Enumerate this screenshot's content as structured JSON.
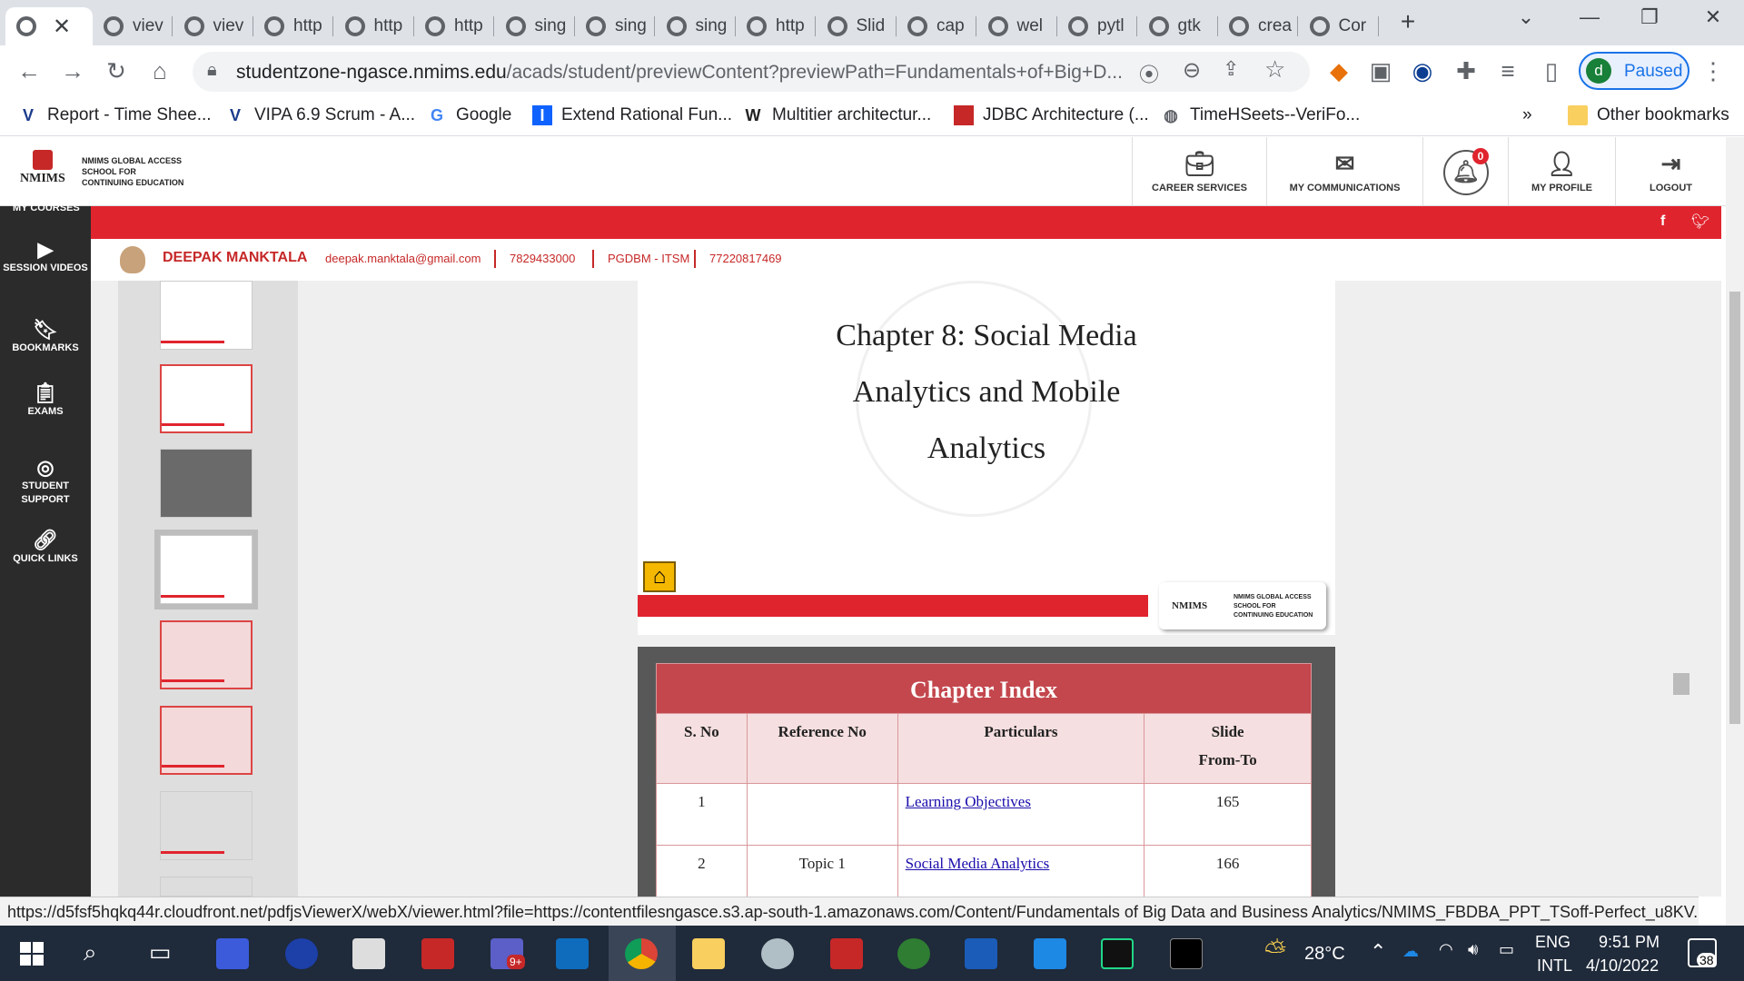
{
  "browser": {
    "tabs": [
      {
        "label": "viev"
      },
      {
        "label": "viev"
      },
      {
        "label": "http"
      },
      {
        "label": "http"
      },
      {
        "label": "http"
      },
      {
        "label": "sing"
      },
      {
        "label": "sing"
      },
      {
        "label": "sing"
      },
      {
        "label": "http"
      },
      {
        "label": "Slid"
      },
      {
        "label": "cap"
      },
      {
        "label": "wel"
      },
      {
        "label": "pytl"
      },
      {
        "label": "gtk"
      },
      {
        "label": "crea"
      },
      {
        "label": "Cor"
      }
    ],
    "url_host": "studentzone-ngasce.nmims.edu",
    "url_rest": "/acads/student/previewContent?previewPath=Fundamentals+of+Big+D...",
    "profile_initial": "d",
    "profile_status": "Paused"
  },
  "bookmarks": [
    {
      "label": "Report - Time Shee...",
      "icon": "v-logo-icon"
    },
    {
      "label": "VIPA 6.9 Scrum - A...",
      "icon": "v-logo-icon"
    },
    {
      "label": "Google",
      "icon": "google-icon"
    },
    {
      "label": "Extend Rational Fun...",
      "icon": "ibm-icon"
    },
    {
      "label": "Multitier architectur...",
      "icon": "wikipedia-icon"
    },
    {
      "label": "JDBC Architecture (...",
      "icon": "red-box-icon"
    },
    {
      "label": "TimeHSeets--VeriFo...",
      "icon": "globe-icon"
    }
  ],
  "bookmarks_more": "»",
  "other_bookmarks": "Other bookmarks",
  "site": {
    "logo_text": "NMIMS",
    "logo_lines": [
      "NMIMS GLOBAL ACCESS",
      "SCHOOL FOR",
      "CONTINUING EDUCATION"
    ],
    "nav": [
      {
        "label": "CAREER SERVICES",
        "icon": "briefcase-icon"
      },
      {
        "label": "MY COMMUNICATIONS",
        "icon": "envelope-icon"
      },
      {
        "label": "",
        "icon": "bell-icon",
        "badge": "0"
      },
      {
        "label": "MY PROFILE",
        "icon": "user-icon"
      },
      {
        "label": "LOGOUT",
        "icon": "logout-icon"
      }
    ],
    "my_courses": "MY COURSES"
  },
  "user": {
    "name": "DEEPAK MANKTALA",
    "email": "deepak.manktala@gmail.com",
    "phone": "7829433000",
    "program": "PGDBM - ITSM",
    "id": "77220817469"
  },
  "sidebar": [
    {
      "label": "SESSION VIDEOS",
      "icon": "play-icon"
    },
    {
      "label": "BOOKMARKS",
      "icon": "bookmark-icon"
    },
    {
      "label": "EXAMS",
      "icon": "exam-icon"
    },
    {
      "label": "STUDENT SUPPORT",
      "icon": "lifebuoy-icon"
    },
    {
      "label": "QUICK LINKS",
      "icon": "link-icon"
    }
  ],
  "slide": {
    "title_lines": [
      "Chapter 8: Social Media",
      "Analytics and Mobile",
      "Analytics"
    ]
  },
  "chapter_index": {
    "title": "Chapter Index",
    "headers": [
      "S. No",
      "Reference No",
      "Particulars",
      "Slide From-To"
    ],
    "header_last_lines": [
      "Slide",
      "From-To"
    ],
    "rows": [
      {
        "sno": "1",
        "ref": "",
        "particulars": "Learning Objectives",
        "slide": "165"
      },
      {
        "sno": "2",
        "ref": "Topic 1",
        "particulars": "Social Media Analytics",
        "slide": "166"
      }
    ]
  },
  "status_url": "https://d5fsf5hqkq44r.cloudfront.net/pdfjsViewerX/webX/viewer.html?file=https://contentfilesngasce.s3.ap-south-1.amazonaws.com/Content/Fundamentals of Big Data and Business Analytics/NMIMS_FBDBA_PPT_TSoff-Perfect_u8KV...",
  "taskbar": {
    "weather": "28°C",
    "lang1": "ENG",
    "lang2": "INTL",
    "time": "9:51 PM",
    "date": "4/10/2022",
    "notifications": "38",
    "teams_badge": "9+"
  }
}
